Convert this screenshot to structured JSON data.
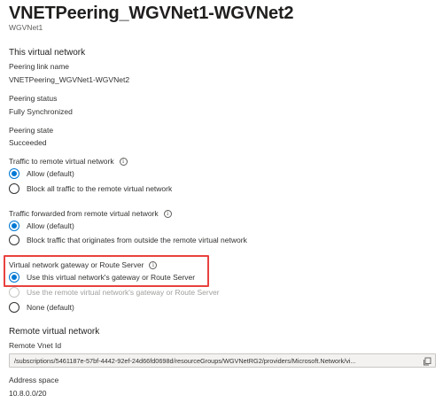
{
  "header": {
    "title": "VNETPeering_WGVNet1-WGVNet2",
    "more_label": "···",
    "subtitle": "WGVNet1"
  },
  "this_vnet": {
    "section_title": "This virtual network",
    "peering_link_name_label": "Peering link name",
    "peering_link_name_value": "VNETPeering_WGVNet1-WGVNet2",
    "peering_status_label": "Peering status",
    "peering_status_value": "Fully Synchronized",
    "peering_state_label": "Peering state",
    "peering_state_value": "Succeeded"
  },
  "traffic_to_remote": {
    "label": "Traffic to remote virtual network",
    "options": [
      {
        "label": "Allow (default)",
        "selected": true
      },
      {
        "label": "Block all traffic to the remote virtual network",
        "selected": false
      }
    ]
  },
  "traffic_forwarded": {
    "label": "Traffic forwarded from remote virtual network",
    "options": [
      {
        "label": "Allow (default)",
        "selected": true
      },
      {
        "label": "Block traffic that originates from outside the remote virtual network",
        "selected": false
      }
    ]
  },
  "gateway": {
    "label": "Virtual network gateway or Route Server",
    "options": [
      {
        "label": "Use this virtual network's gateway or Route Server",
        "selected": true,
        "disabled": false
      },
      {
        "label": "Use the remote virtual network's gateway or Route Server",
        "selected": false,
        "disabled": true
      },
      {
        "label": "None (default)",
        "selected": false,
        "disabled": false
      }
    ]
  },
  "remote_vnet": {
    "section_title": "Remote virtual network",
    "remote_vnet_id_label": "Remote Vnet Id",
    "remote_vnet_id_value": "/subscriptions/5461187e-57bf-4442-92ef-24d66fd0698d/resourceGroups/WGVNetRG2/providers/Microsoft.Network/vi...",
    "address_space_label": "Address space",
    "address_space_value": "10.8.0.0/20"
  },
  "colors": {
    "accent": "#0078d4",
    "highlight": "#e8423f"
  }
}
